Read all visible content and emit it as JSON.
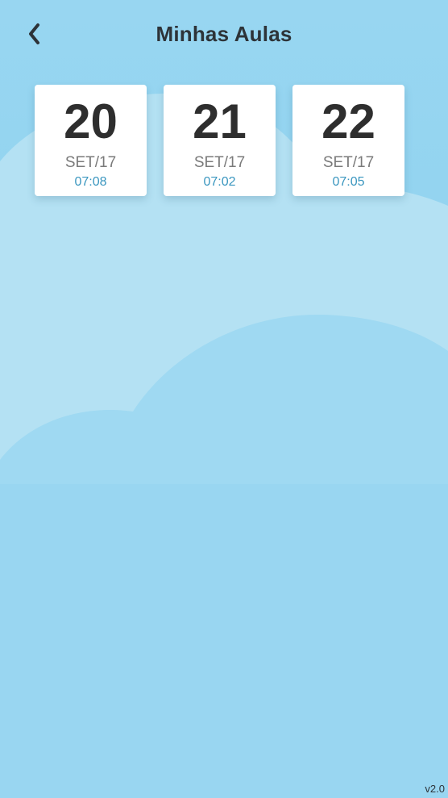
{
  "header": {
    "title": "Minhas Aulas",
    "back_icon": "chevron-left-icon"
  },
  "classes": [
    {
      "day": "20",
      "month": "SET/17",
      "time": "07:08"
    },
    {
      "day": "21",
      "month": "SET/17",
      "time": "07:02"
    },
    {
      "day": "22",
      "month": "SET/17",
      "time": "07:05"
    }
  ],
  "footer": {
    "version": "v2.0"
  },
  "colors": {
    "background": "#8ed1ef",
    "cloud_light": "#b4e1f3",
    "title_text": "#2d3338",
    "time_text": "#3a96bf",
    "card": "#ffffff"
  }
}
